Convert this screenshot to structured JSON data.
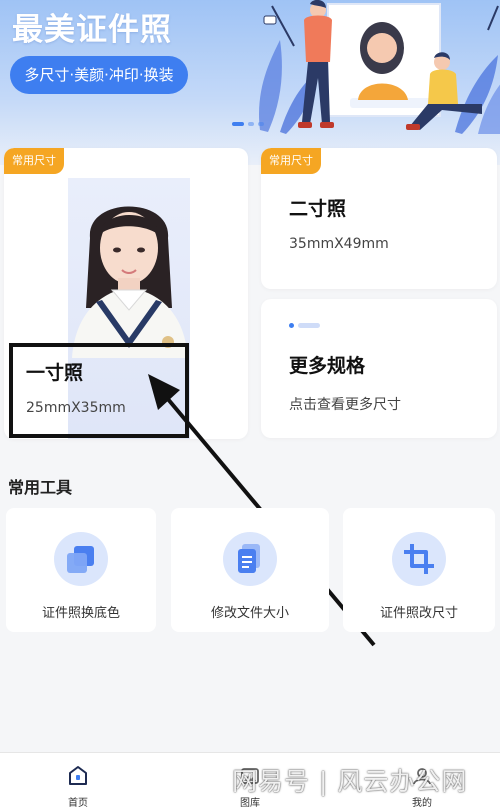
{
  "banner": {
    "title": "最美证件照",
    "pill": "多尺寸·美颜·冲印·换装"
  },
  "cards": {
    "one_inch": {
      "tag": "常用尺寸",
      "title": "一寸照",
      "size": "25mmX35mm"
    },
    "two_inch": {
      "tag": "常用尺寸",
      "title": "二寸照",
      "size": "35mmX49mm"
    },
    "more": {
      "title": "更多规格",
      "subtitle": "点击查看更多尺寸"
    }
  },
  "tools": {
    "section_title": "常用工具",
    "items": [
      {
        "label": "证件照换底色",
        "icon": "layers-icon"
      },
      {
        "label": "修改文件大小",
        "icon": "document-icon"
      },
      {
        "label": "证件照改尺寸",
        "icon": "crop-icon"
      }
    ]
  },
  "tabbar": {
    "items": [
      {
        "label": "首页",
        "icon": "home-icon",
        "active": true
      },
      {
        "label": "图库",
        "icon": "gallery-icon",
        "active": false
      },
      {
        "label": "我的",
        "icon": "profile-icon",
        "active": false
      }
    ]
  },
  "watermark": "网易号 | 风云办公网",
  "colors": {
    "accent": "#3e7ef0",
    "tag": "#f5a623",
    "banner_top": "#9fc3f5",
    "tool_icon_bg": "#dbe6fc",
    "background": "#f5f6f8"
  }
}
